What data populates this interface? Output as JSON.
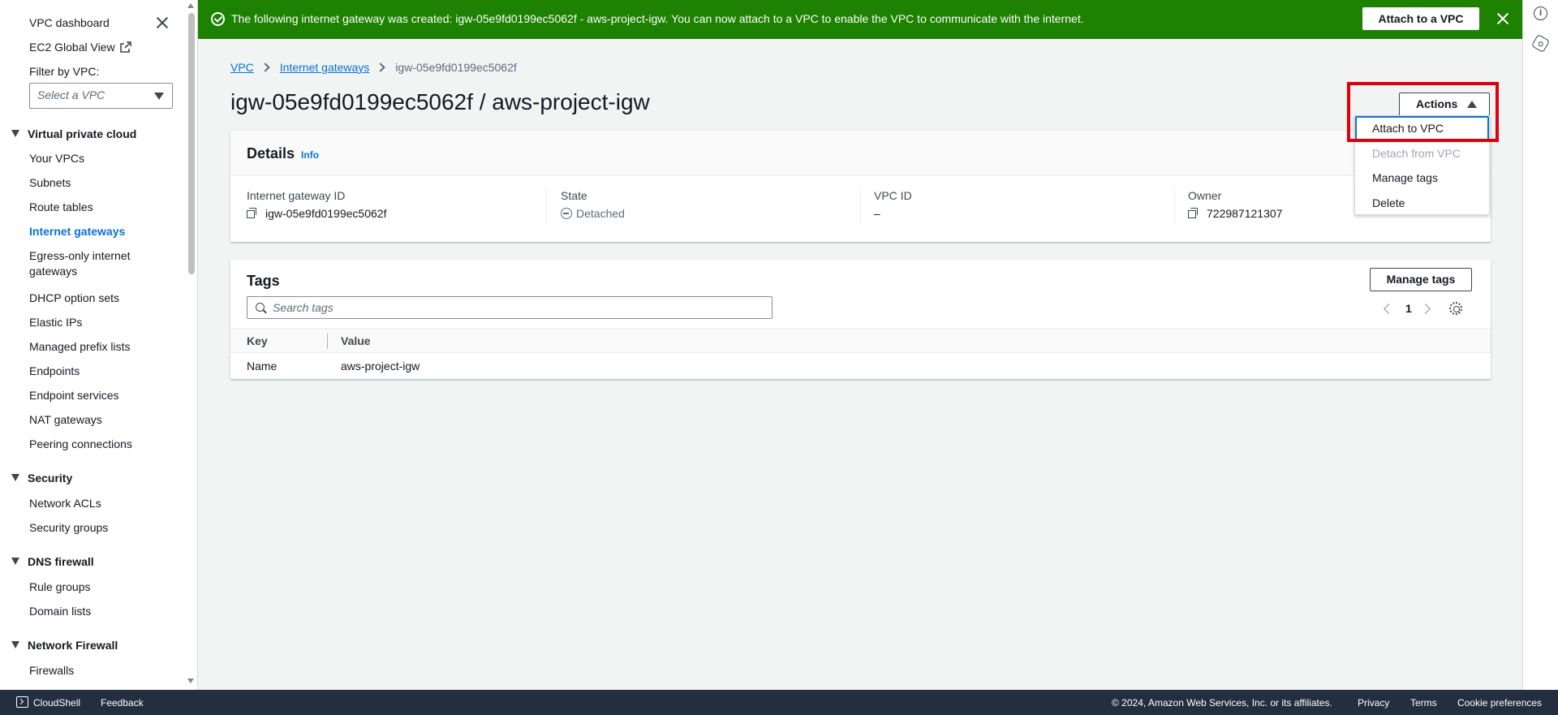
{
  "sidebar": {
    "dashboard": "VPC dashboard",
    "global_view": "EC2 Global View",
    "filter_label": "Filter by VPC:",
    "filter_placeholder": "Select a VPC",
    "sections": [
      {
        "title": "Virtual private cloud",
        "items": [
          "Your VPCs",
          "Subnets",
          "Route tables",
          "Internet gateways",
          "Egress-only internet gateways",
          "DHCP option sets",
          "Elastic IPs",
          "Managed prefix lists",
          "Endpoints",
          "Endpoint services",
          "NAT gateways",
          "Peering connections"
        ]
      },
      {
        "title": "Security",
        "items": [
          "Network ACLs",
          "Security groups"
        ]
      },
      {
        "title": "DNS firewall",
        "items": [
          "Rule groups",
          "Domain lists"
        ]
      },
      {
        "title": "Network Firewall",
        "items": [
          "Firewalls"
        ]
      }
    ],
    "active_item": "Internet gateways",
    "egress_line1": "Egress-only internet",
    "egress_line2": "gateways"
  },
  "flash": {
    "message": "The following internet gateway was created: igw-05e9fd0199ec5062f - aws-project-igw. You can now attach to a VPC to enable the VPC to communicate with the internet.",
    "button_label": "Attach to a VPC",
    "color": "#1d8102"
  },
  "breadcrumb": {
    "items": [
      "VPC",
      "Internet gateways"
    ],
    "current": "igw-05e9fd0199ec5062f"
  },
  "page_title": "igw-05e9fd0199ec5062f / aws-project-igw",
  "actions": {
    "label": "Actions",
    "menu": [
      "Attach to VPC",
      "Detach from VPC",
      "Manage tags",
      "Delete"
    ],
    "highlight_color": "#e0000b"
  },
  "details": {
    "title": "Details",
    "info": "Info",
    "fields": [
      {
        "label": "Internet gateway ID",
        "value": "igw-05e9fd0199ec5062f"
      },
      {
        "label": "State",
        "value": "Detached"
      },
      {
        "label": "VPC ID",
        "value": "–"
      },
      {
        "label": "Owner",
        "value": "722987121307"
      }
    ]
  },
  "tags": {
    "title": "Tags",
    "manage_label": "Manage tags",
    "search_placeholder": "Search tags",
    "page": "1",
    "columns": [
      "Key",
      "Value"
    ],
    "rows": [
      {
        "key": "Name",
        "value": "aws-project-igw"
      }
    ]
  },
  "footer": {
    "cloudshell": "CloudShell",
    "feedback": "Feedback",
    "copyright": "© 2024, Amazon Web Services, Inc. or its affiliates.",
    "privacy": "Privacy",
    "terms": "Terms",
    "cookies": "Cookie preferences"
  }
}
